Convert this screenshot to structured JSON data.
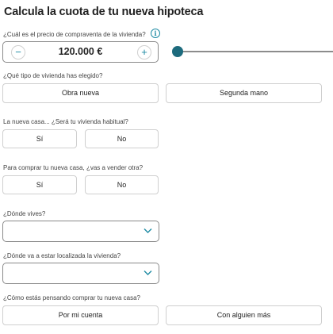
{
  "title": "Calcula la cuota de tu nueva hipoteca",
  "price": {
    "label": "¿Cuál es el precio de compraventa de la vivienda?",
    "info_icon": "i",
    "minus": "−",
    "plus": "+",
    "value": "120.000 €",
    "slider_level": 0.0
  },
  "housing_type": {
    "label": "¿Qué tipo de vivienda has elegido?",
    "options": [
      "Obra nueva",
      "Segunda mano"
    ]
  },
  "habitual": {
    "label": "La nueva casa... ¿Será tu vivienda habitual?",
    "options": [
      "Sí",
      "No"
    ]
  },
  "sell_other": {
    "label": "Para comprar tu nueva casa, ¿vas a vender otra?",
    "options": [
      "Sí",
      "No"
    ]
  },
  "residence": {
    "label": "¿Dónde vives?",
    "value": ""
  },
  "location": {
    "label": "¿Dónde va a estar localizada la vivienda?",
    "value": ""
  },
  "buy_mode": {
    "label": "¿Cómo estás pensando comprar tu nueva casa?",
    "options": [
      "Por mi cuenta",
      "Con alguien más"
    ]
  },
  "colors": {
    "accent": "#1d8aa3",
    "slider_thumb": "#1d6b7d",
    "border": "#cfcfcf"
  }
}
